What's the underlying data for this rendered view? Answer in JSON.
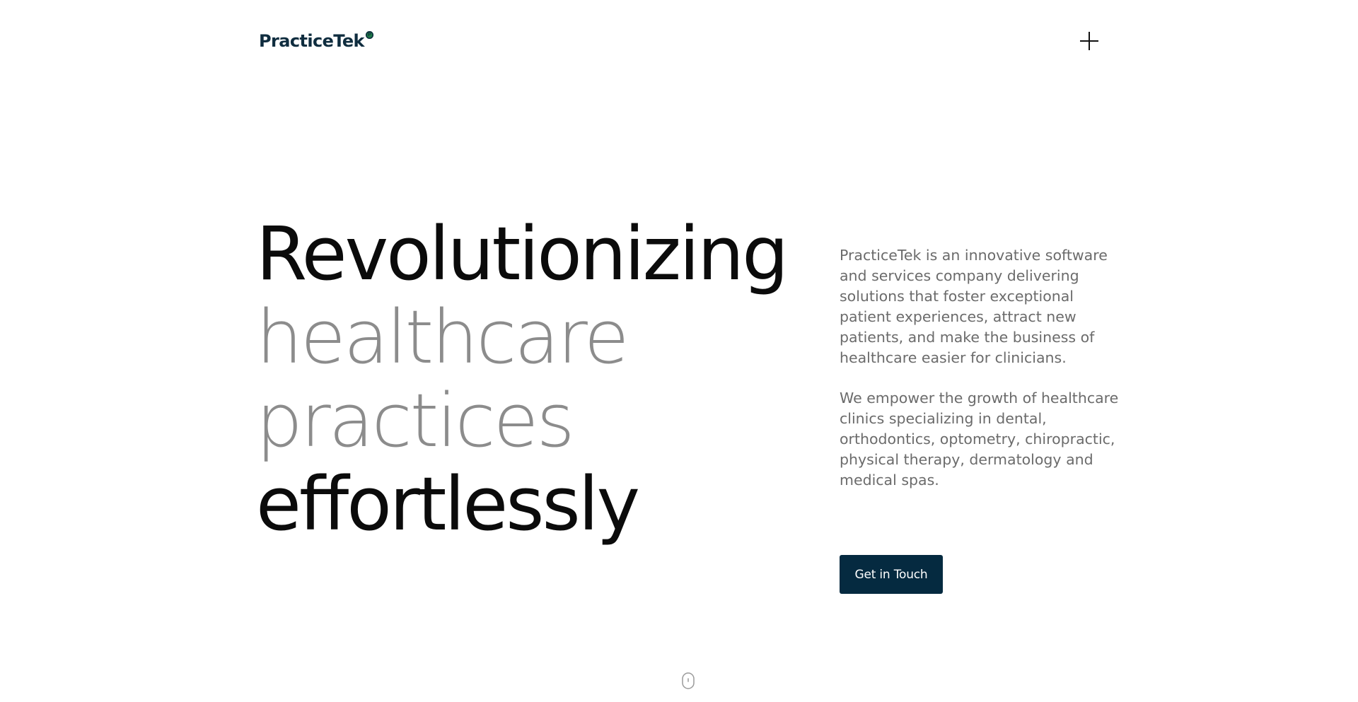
{
  "header": {
    "logo_text": "PracticeTek",
    "logo_mark": "P",
    "menu_icon": "plus-icon"
  },
  "hero": {
    "headline": {
      "line1": "Revolutionizing",
      "line2": "healthcare",
      "line3": "practices",
      "line4": "effortlessly"
    },
    "paragraph1": "PracticeTek is an innovative software and services company delivering solutions that foster exceptional patient experiences, attract new patients, and make the business of healthcare easier for clinicians.",
    "paragraph2": "We empower the growth of healthcare clinics specializing in dental, orthodontics, optometry, chiropractic, physical therapy, dermatology and medical spas.",
    "cta_label": "Get in Touch",
    "scroll_icon": "mouse-scroll-icon"
  },
  "colors": {
    "brand_navy": "#052a40",
    "headline_dark": "#0b0b0b",
    "headline_light": "#8c8c8c",
    "body_text": "#6b6b6b",
    "logo_green": "#1e7a46"
  }
}
